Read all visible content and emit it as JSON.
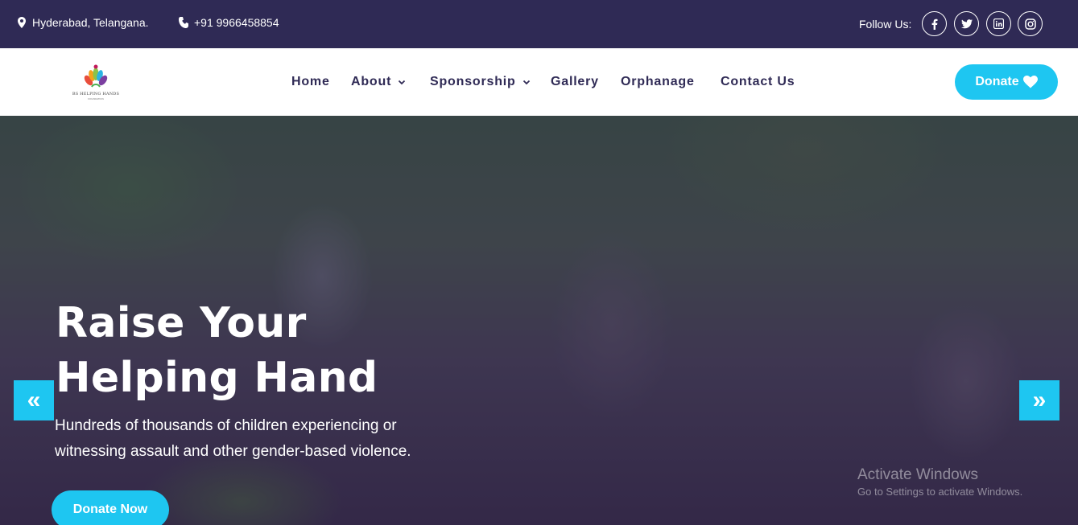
{
  "topbar": {
    "location": "Hyderabad, Telangana.",
    "phone": "+91 9966458854",
    "follow_label": "Follow Us:",
    "social": [
      "facebook-icon",
      "twitter-icon",
      "linkedin-icon",
      "instagram-icon"
    ]
  },
  "logo": {
    "name": "BS HELPING HANDS",
    "tagline": "FOUNDATION"
  },
  "nav": {
    "home": "Home",
    "about": "About",
    "sponsorship": "Sponsorship",
    "gallery": "Gallery",
    "orphanage": "Orphanage",
    "contact": "Contact Us",
    "donate": "Donate"
  },
  "hero": {
    "title_line1": "Raise Your",
    "title_line2": "Helping Hand",
    "subtitle_line1": "Hundreds of thousands of children experiencing or",
    "subtitle_line2": "witnessing assault and other gender-based violence.",
    "cta": "Donate Now",
    "prev_arrow": "«",
    "next_arrow": "»"
  },
  "watermark": {
    "line1": "Activate Windows",
    "line2": "Go to Settings to activate Windows."
  },
  "colors": {
    "topbar_bg": "#2f2a55",
    "accent": "#1ec6f1",
    "nav_text": "#2f2a55"
  }
}
